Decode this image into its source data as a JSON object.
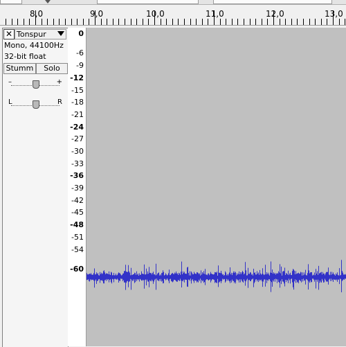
{
  "ruler": {
    "labels": [
      "8,0",
      "9,0",
      "10,0",
      "11,0",
      "12,0",
      "13,0"
    ]
  },
  "track": {
    "name": "Tonspur",
    "close_icon": "close-icon",
    "menu_icon": "chevron-down-icon",
    "format": "Mono, 44100Hz",
    "bit_depth": "32-bit float",
    "mute_label": "Stumm",
    "solo_label": "Solo",
    "gain": {
      "min_label": "–",
      "max_label": "+",
      "value": 0.5
    },
    "pan": {
      "left_label": "L",
      "right_label": "R",
      "value": 0.5
    }
  },
  "db_scale": {
    "labels": [
      "0",
      "-6",
      "-9",
      "-12",
      "-15",
      "-18",
      "-21",
      "-24",
      "-27",
      "-30",
      "-33",
      "-36",
      "-39",
      "-42",
      "-45",
      "-48",
      "-51",
      "-54",
      "-60"
    ],
    "bold": [
      "0",
      "-12",
      "-24",
      "-36",
      "-48",
      "-60"
    ]
  },
  "waveform": {
    "color": "#3232c8",
    "background": "#c0c0c0",
    "level_db": "-60"
  }
}
